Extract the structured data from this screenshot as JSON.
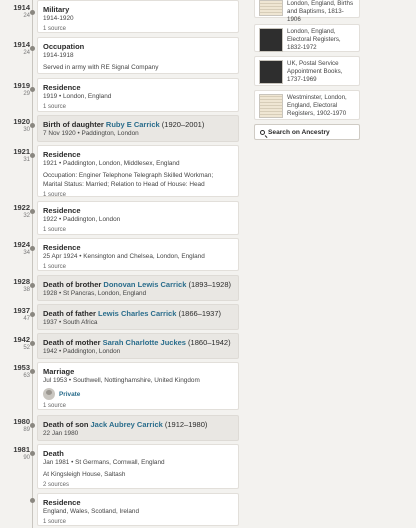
{
  "events": [
    {
      "year": "1914",
      "age": "24",
      "title": "Military",
      "sub": "1914-1920",
      "source": "1 source"
    },
    {
      "year": "1914",
      "age": "24",
      "title": "Occupation",
      "sub": "1914-1918",
      "desc": "Served in army with RE Signal Company"
    },
    {
      "year": "1919",
      "age": "29",
      "title": "Residence",
      "sub": "1919 • London, England",
      "source": "1 source"
    },
    {
      "year": "1920",
      "age": "30",
      "title_prefix": "Birth of daughter ",
      "link": "Ruby E Carrick",
      "span": " (1920–2001)",
      "sub": "7 Nov 1920 • Paddington, London"
    },
    {
      "year": "1921",
      "age": "31",
      "title": "Residence",
      "sub": "1921 • Paddington, London, Middlesex, England",
      "desc": "Occupation: Enginer Telephone Telegraph Skilled Workman; Marital Status: Married; Relation to Head of House: Head",
      "source": "1 source"
    },
    {
      "year": "1922",
      "age": "32",
      "title": "Residence",
      "sub": "1922 • Paddington, London",
      "source": "1 source"
    },
    {
      "year": "1924",
      "age": "34",
      "title": "Residence",
      "sub": "25 Apr 1924 • Kensington and Chelsea, London, England",
      "source": "1 source"
    },
    {
      "year": "1928",
      "age": "38",
      "title_prefix": "Death of brother ",
      "link": "Donovan Lewis Carrick",
      "span": " (1893–1928)",
      "sub": "1928 • St Pancras, London, England"
    },
    {
      "year": "1937",
      "age": "47",
      "title_prefix": "Death of father ",
      "link": "Lewis Charles Carrick",
      "span": " (1866–1937)",
      "sub": "1937 • South Africa"
    },
    {
      "year": "1942",
      "age": "52",
      "title_prefix": "Death of mother ",
      "link": "Sarah Charlotte Juckes",
      "span": " (1860–1942)",
      "sub": "1942 • Paddington, London"
    },
    {
      "year": "1953",
      "age": "63",
      "title": "Marriage",
      "sub": "Jul 1953 • Southwell, Nottinghamshire, United Kingdom",
      "person": "Private",
      "source": "1 source"
    },
    {
      "year": "1980",
      "age": "89",
      "title_prefix": "Death of son ",
      "link": "Jack Aubrey Carrick",
      "span": " (1912–1980)",
      "sub": "22 Jan 1980"
    },
    {
      "year": "1981",
      "age": "90",
      "title": "Death",
      "sub": "Jan 1981 • St Germans, Cornwall, England",
      "desc": "At Kingsleigh House, Saltash",
      "source": "2 sources"
    },
    {
      "title": "Residence",
      "sub": "England, Wales, Scotland, Ireland",
      "source": "1 source"
    }
  ],
  "records": [
    {
      "text": "London, England, Births and Baptisms, 1813-1906"
    },
    {
      "text": "London, England, Electoral Registers, 1832-1972"
    },
    {
      "text": "UK, Postal Service Appointment Books, 1737-1969"
    },
    {
      "text": "Westminster, London, England, Electoral Registers, 1902-1970"
    }
  ],
  "search_label": "Search on Ancestry",
  "colors": {
    "link": "#2a6d8c",
    "background": "#f3f2ef",
    "highlight_card": "#e9e7e3"
  }
}
